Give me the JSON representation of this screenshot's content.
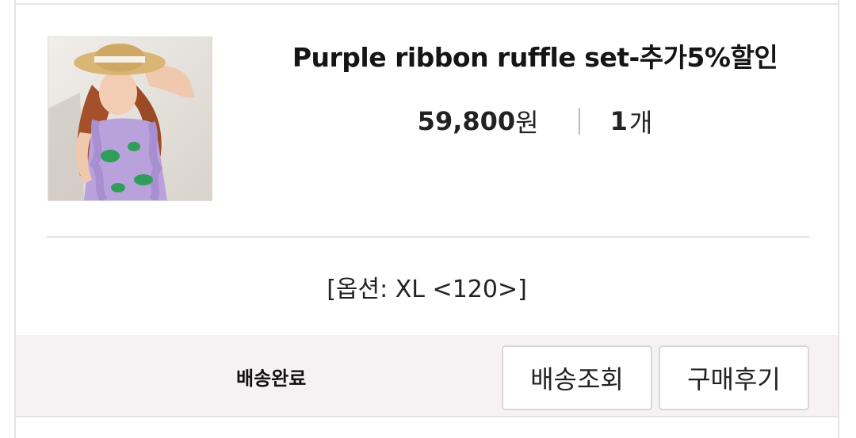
{
  "order_item": {
    "product_name": "Purple ribbon ruffle set-추가5%할인",
    "price_number": "59,800",
    "price_unit": "원",
    "quantity_number": "1",
    "quantity_unit": "개",
    "option_text": "[옵션: XL <120>]",
    "thumbnail": "girl-in-straw-hat-purple-ruffle-dress-photo"
  },
  "footer": {
    "status": "배송완료",
    "track_button": "배송조회",
    "review_button": "구매후기"
  },
  "colors": {
    "footer_bg": "#f6f2f3",
    "dress_purple": "#b9a2dc",
    "print_green": "#2e9e5a"
  }
}
